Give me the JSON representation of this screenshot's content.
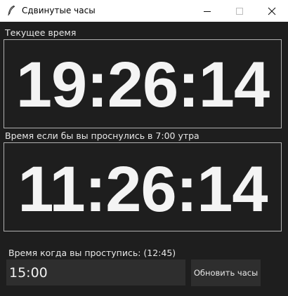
{
  "window": {
    "title": "Сдвинутые часы",
    "icon": "feather-icon"
  },
  "current_time": {
    "label": "Текущее время",
    "value": "19:26:14"
  },
  "shifted_time": {
    "label": "Время если бы вы проснулись в 7:00 утра",
    "value": "11:26:14"
  },
  "wake": {
    "label": "Время когда вы проступись: (12:45)",
    "input_value": "15:00",
    "button_label": "Обновить часы"
  },
  "colors": {
    "background": "#1e1e1e",
    "text": "#f4f4f4",
    "frame_border": "#b0b0b0",
    "control_bg": "#2e2e2e"
  }
}
